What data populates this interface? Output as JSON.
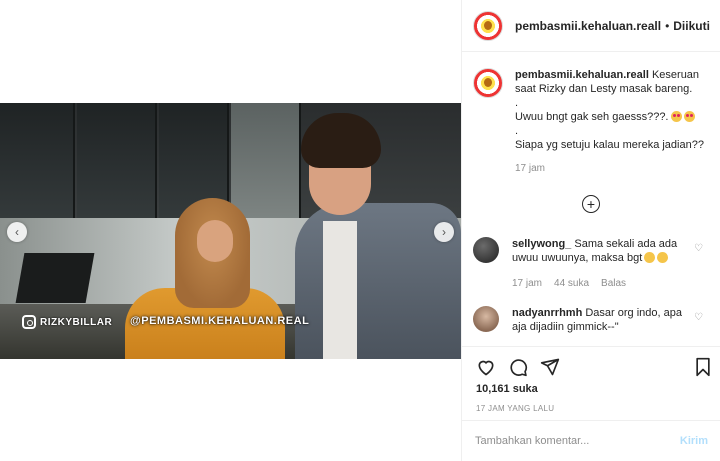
{
  "post": {
    "watermark_handle": "RIZKYBILLAR",
    "watermark_account": "@PEMBASMI.KEHALUAN.REAL"
  },
  "header": {
    "username": "pembasmii.kehaluan.reall",
    "separator": "•",
    "follow_label": "Diikuti"
  },
  "caption": {
    "username": "pembasmii.kehaluan.reall",
    "lines": [
      "Keseruan saat Rizky dan Lesty masak bareng.",
      ".",
      "Uwuu bngt gak seh gaesss???.",
      ".",
      "Siapa yg setuju kalau mereka jadian??"
    ],
    "time": "17 jam"
  },
  "comments": [
    {
      "username": "sellywong_",
      "text": "Sama sekali ada ada uwuu uwuunya, maksa bgt",
      "time": "17 jam",
      "likes": "44 suka",
      "reply_label": "Balas"
    },
    {
      "username": "nadyanrrhmh",
      "text": "Dasar org indo, apa aja dijadiin gimmick--\""
    }
  ],
  "likes": "10,161 suka",
  "post_time": "17 JAM YANG LALU",
  "composer": {
    "placeholder": "Tambahkan komentar...",
    "send_label": "Kirim"
  },
  "icons": {
    "like": "heart-icon",
    "comment": "comment-icon",
    "share": "share-icon",
    "save": "bookmark-icon",
    "more": "plus-circle-icon"
  }
}
